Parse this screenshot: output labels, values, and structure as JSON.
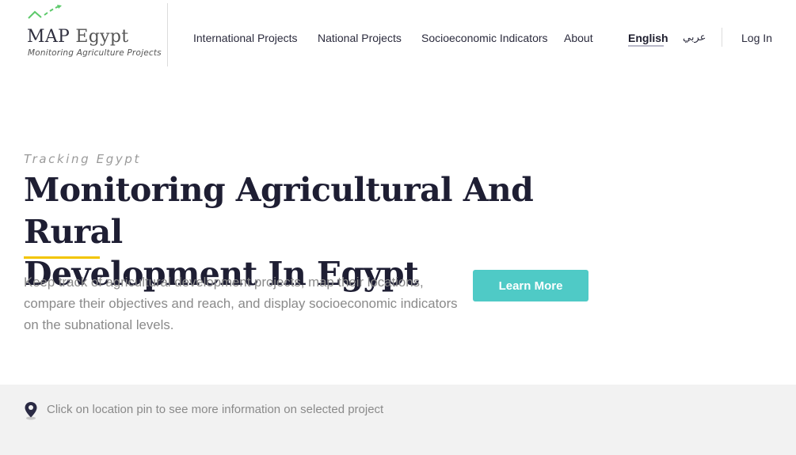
{
  "logo": {
    "title_strong": "MAP",
    "title_light": "Egypt",
    "subtitle": "Monitoring Agriculture Projects",
    "mark_color": "#5cc96a"
  },
  "nav": {
    "items": [
      "International Projects",
      "National Projects",
      "Socioeconomic Indicators",
      "About"
    ],
    "lang_english": "English",
    "lang_arabic": "عربي",
    "login": "Log In"
  },
  "hero": {
    "kicker": "Tracking Egypt",
    "headline_line1": "Monitoring Agricultural And Rural",
    "headline_line2": "Development In Egypt",
    "description": "Keep track of agricultural development projects, map their locations, compare their objectives and reach, and display socioeconomic indicators on the subnational levels.",
    "cta_label": "Learn More",
    "accent_color": "#f2c500",
    "cta_color": "#4fcac6"
  },
  "map_hint": {
    "icon": "location-pin-icon",
    "text": "Click on location pin to see more information on selected project"
  }
}
